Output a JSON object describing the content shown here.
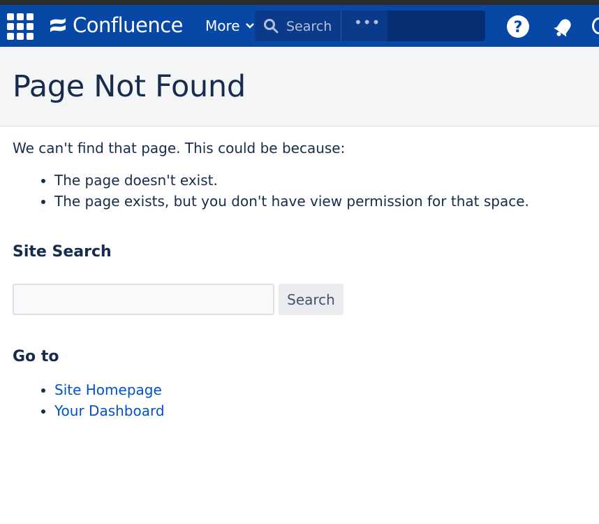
{
  "nav": {
    "logo_text": "Confluence",
    "more_label": "More",
    "search_label": "Search",
    "ellipsis": "•••",
    "bar_color": "#0747a6"
  },
  "page": {
    "title": "Page Not Found",
    "intro": "We can't find that page. This could be because:",
    "reasons": [
      "The page doesn't exist.",
      "The page exists, but you don't have view permission for that space."
    ]
  },
  "site_search": {
    "title": "Site Search",
    "input_value": "",
    "button_label": "Search"
  },
  "goto": {
    "title": "Go to",
    "links": [
      "Site Homepage",
      "Your Dashboard"
    ]
  },
  "colors": {
    "link": "#0052cc",
    "text": "#172b4d",
    "header_band": "#f4f5f7"
  }
}
